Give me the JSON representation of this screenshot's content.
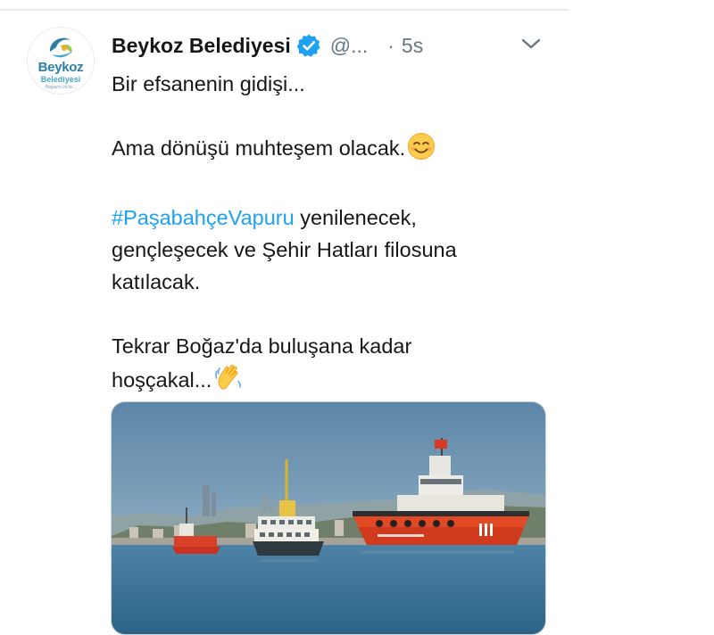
{
  "tweet": {
    "avatar": {
      "brand_name": "Beykoz",
      "brand_sub": "Belediyesi",
      "brand_slogan": "Boğazın incisi..."
    },
    "display_name": "Beykoz Belediyesi",
    "verified": true,
    "handle": "@...",
    "separator": "·",
    "timestamp": "5s",
    "more_icon": "chevron-down-icon",
    "lines": {
      "l1": "Bir efsanenin gidişi...",
      "l2": "Ama dönüşü muhteşem olacak.",
      "l3_hashtag": "#PaşabahçeVapuru",
      "l3_rest": " yenilenecek,",
      "l4": "gençleşecek ve Şehir Hatları filosuna",
      "l5": "katılacak.",
      "l6": "Tekrar Boğaz'da buluşana kadar",
      "l7": "hoşçakal..."
    },
    "emojis": {
      "smile": "smiling-face-icon",
      "wave": "waving-hand-icon"
    },
    "media": {
      "type": "photo"
    }
  },
  "colors": {
    "link": "#1da1f2",
    "secondary_text": "#657786",
    "primary_text": "#14171a",
    "verified_badge": "#1da1f2",
    "divider": "#e6ecf0"
  }
}
